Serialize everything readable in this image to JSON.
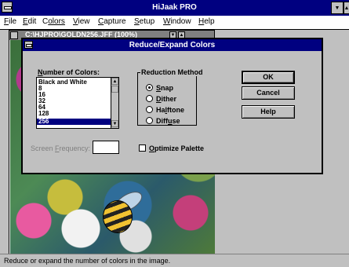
{
  "app": {
    "title": "HiJaak PRO"
  },
  "menu": {
    "items": [
      {
        "label": "File",
        "key": "F",
        "rest": "ile"
      },
      {
        "label": "Edit",
        "key": "E",
        "rest": "dit"
      },
      {
        "label": "Colors",
        "key": "C",
        "rest": "olors"
      },
      {
        "label": "View",
        "key": "V",
        "rest": "iew"
      },
      {
        "label": "Capture",
        "key": "C",
        "rest": "apture"
      },
      {
        "label": "Setup",
        "key": "S",
        "rest": "etup"
      },
      {
        "label": "Window",
        "key": "W",
        "rest": "indow"
      },
      {
        "label": "Help",
        "key": "H",
        "rest": "elp"
      }
    ]
  },
  "document": {
    "title": "C:\\HJPRO\\GOLDN256.JFF (100%)"
  },
  "dialog": {
    "title": "Reduce/Expand Colors",
    "colors_label_key": "N",
    "colors_label_rest": "umber of Colors:",
    "colors_options": [
      "Black and White",
      "8",
      "16",
      "32",
      "64",
      "128",
      "256"
    ],
    "colors_selected": "256",
    "method_label": "Reduction Method",
    "methods": [
      {
        "key": "S",
        "rest": "nap",
        "checked": true
      },
      {
        "key": "D",
        "rest": "ither",
        "checked": false
      },
      {
        "pre": "Ha",
        "key": "l",
        "rest": "ftone",
        "checked": false
      },
      {
        "pre": "Diff",
        "key": "u",
        "rest": "se",
        "checked": false
      }
    ],
    "ok_label": "OK",
    "cancel_label": "Cancel",
    "help_label": "Help",
    "freq_label_pre": "Screen ",
    "freq_label_key": "F",
    "freq_label_rest": "requency:",
    "freq_value": "",
    "optimize_key": "O",
    "optimize_rest": "ptimize Palette",
    "optimize_checked": false
  },
  "status": {
    "text": "Reduce or expand the number of colors in the image."
  }
}
